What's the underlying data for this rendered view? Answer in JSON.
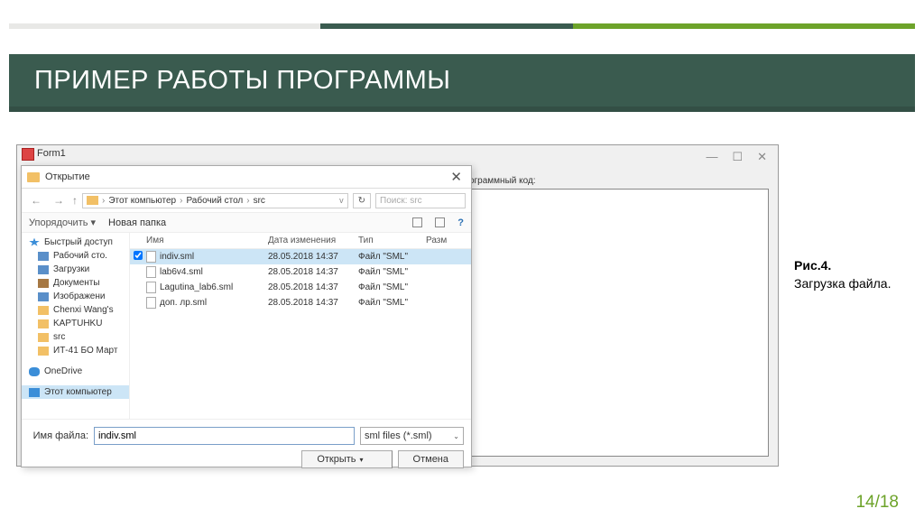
{
  "slide": {
    "title": "ПРИМЕР РАБОТЫ ПРОГРАММЫ",
    "pagenum": "14/18",
    "caption_bold": "Рис.4.",
    "caption_text": "Загрузка файла."
  },
  "form1": {
    "title": "Form1",
    "label": "программный код:",
    "min": "—",
    "max": "☐",
    "close": "✕"
  },
  "dialog": {
    "title": "Открытие",
    "close": "✕",
    "nav": {
      "back": "←",
      "fwd": "→",
      "up": "↑",
      "path1": "Этот компьютер",
      "path2": "Рабочий стол",
      "path3": "src",
      "refresh": "↻",
      "search_placeholder": "Поиск: src"
    },
    "toolbar": {
      "organize": "Упорядочить ▾",
      "newfolder": "Новая папка",
      "help": "?"
    },
    "sidebar": [
      {
        "icon": "star",
        "label": "Быстрый доступ",
        "sub": false
      },
      {
        "icon": "desktop",
        "label": "Рабочий сто.",
        "sub": true
      },
      {
        "icon": "download",
        "label": "Загрузки",
        "sub": true
      },
      {
        "icon": "doc",
        "label": "Документы",
        "sub": true
      },
      {
        "icon": "pic",
        "label": "Изображени",
        "sub": true
      },
      {
        "icon": "folder",
        "label": "Chenxi Wang's",
        "sub": true
      },
      {
        "icon": "folder",
        "label": "KAPTUHKU",
        "sub": true
      },
      {
        "icon": "folder",
        "label": "src",
        "sub": true
      },
      {
        "icon": "folder",
        "label": "ИТ-41 БО Март",
        "sub": true
      }
    ],
    "sidebar_onedrive": "OneDrive",
    "sidebar_thispc": "Этот компьютер",
    "columns": {
      "name": "Имя",
      "date": "Дата изменения",
      "type": "Тип",
      "size": "Разм"
    },
    "files": [
      {
        "name": "indiv.sml",
        "date": "28.05.2018 14:37",
        "type": "Файл \"SML\"",
        "sel": true
      },
      {
        "name": "lab6v4.sml",
        "date": "28.05.2018 14:37",
        "type": "Файл \"SML\"",
        "sel": false
      },
      {
        "name": "Lagutina_lab6.sml",
        "date": "28.05.2018 14:37",
        "type": "Файл \"SML\"",
        "sel": false
      },
      {
        "name": "доп. лр.sml",
        "date": "28.05.2018 14:37",
        "type": "Файл \"SML\"",
        "sel": false
      }
    ],
    "footer": {
      "filename_label": "Имя файла:",
      "filename_value": "indiv.sml",
      "filter": "sml files (*.sml)",
      "open": "Открыть",
      "cancel": "Отмена"
    }
  }
}
